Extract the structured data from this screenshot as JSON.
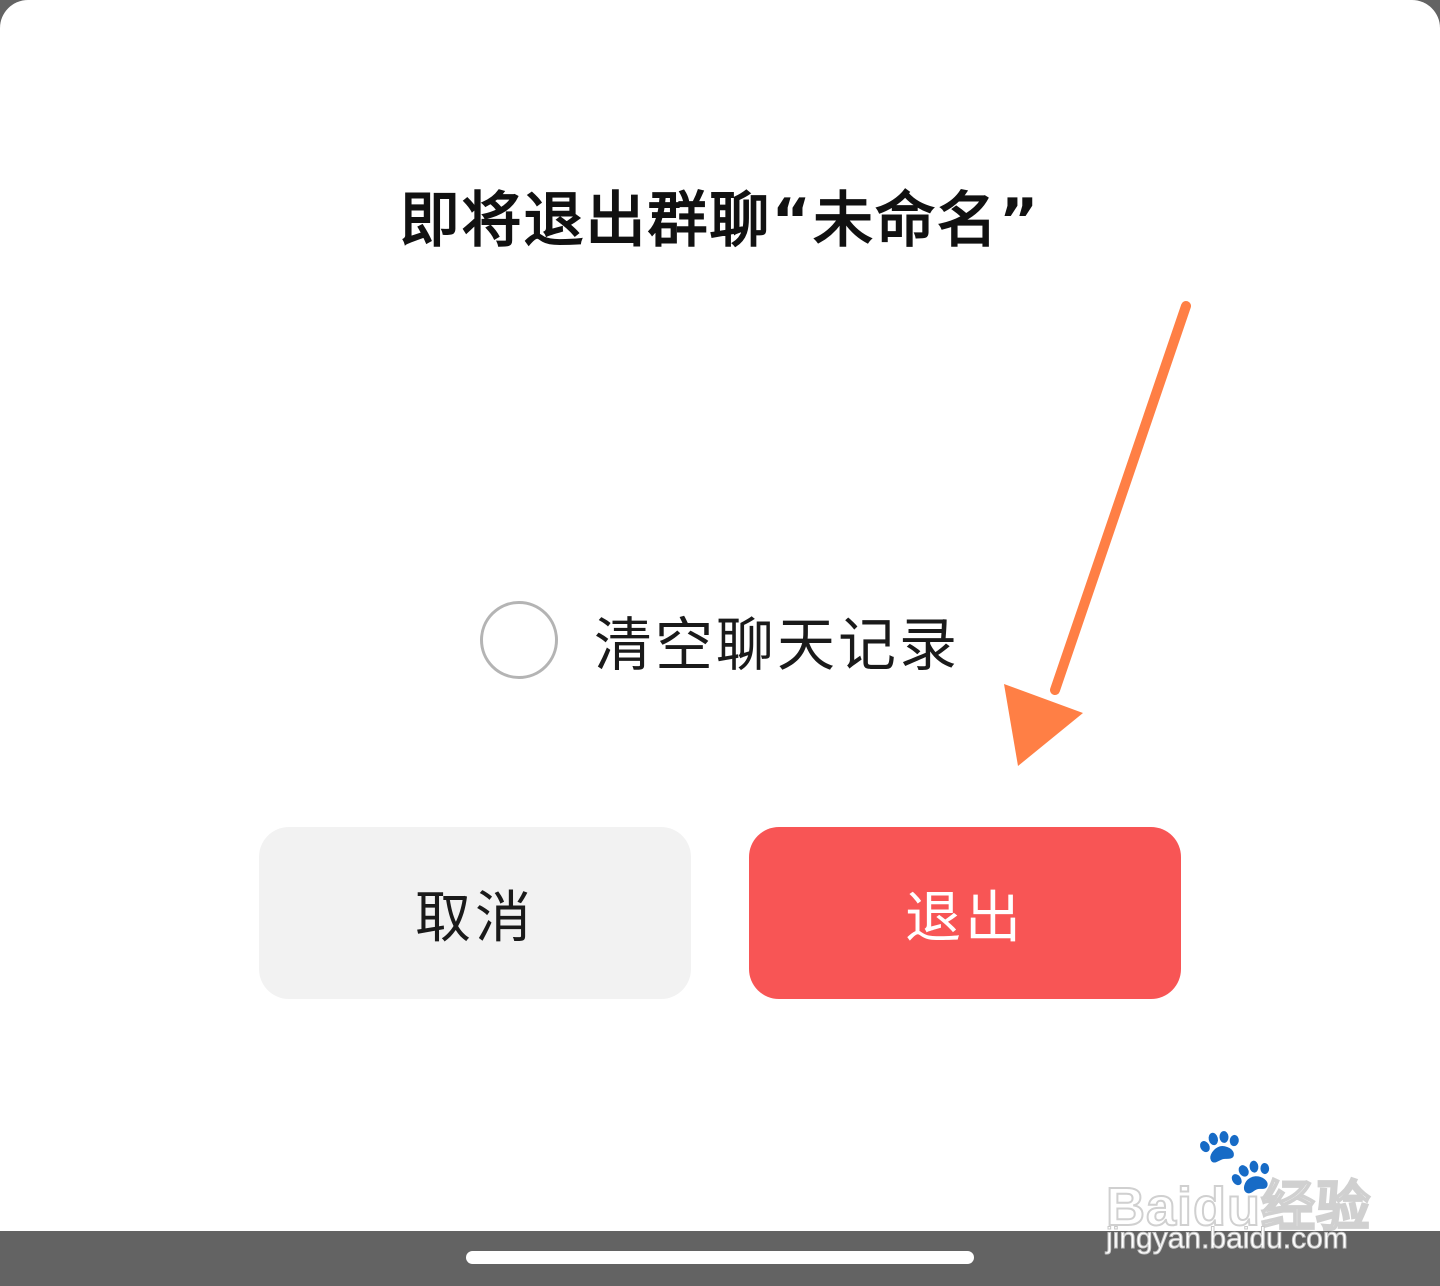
{
  "dialog": {
    "title": "即将退出群聊“未命名”",
    "clear_history_label": "清空聊天记录",
    "clear_history_checked": false,
    "cancel_label": "取消",
    "exit_label": "退出"
  },
  "watermark": {
    "brand": "Baidu经验",
    "url": "jingyan.baidu.com"
  },
  "annotation": {
    "arrow_color": "#ff7f45",
    "arrow_target": "exit-button"
  },
  "colors": {
    "exit_button": "#f85555",
    "cancel_button": "#f2f2f2",
    "nav_bar": "#636363"
  }
}
